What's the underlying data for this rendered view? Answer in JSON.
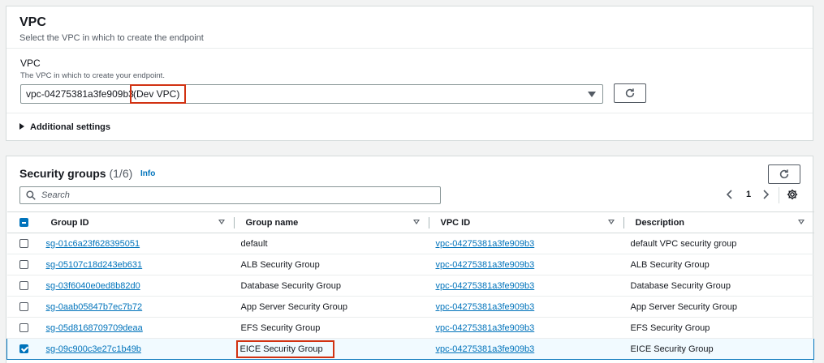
{
  "vpc_panel": {
    "title": "VPC",
    "subtitle": "Select the VPC in which to create the endpoint",
    "field_label": "VPC",
    "field_description": "The VPC in which to create your endpoint.",
    "selected_vpc_id": "vpc-04275381a3fe909b3",
    "selected_vpc_name": "(Dev VPC)",
    "additional_settings": "Additional settings"
  },
  "security_groups": {
    "title": "Security groups",
    "count": "(1/6)",
    "info": "Info",
    "search_placeholder": "Search",
    "page": "1",
    "columns": [
      "Group ID",
      "Group name",
      "VPC ID",
      "Description"
    ],
    "rows": [
      {
        "group_id": "sg-01c6a23f628395051",
        "group_name": "default",
        "vpc_id": "vpc-04275381a3fe909b3",
        "description": "default VPC security group",
        "checked": false
      },
      {
        "group_id": "sg-05107c18d243eb631",
        "group_name": "ALB Security Group",
        "vpc_id": "vpc-04275381a3fe909b3",
        "description": "ALB Security Group",
        "checked": false
      },
      {
        "group_id": "sg-03f6040e0ed8b82d0",
        "group_name": "Database Security Group",
        "vpc_id": "vpc-04275381a3fe909b3",
        "description": "Database Security Group",
        "checked": false
      },
      {
        "group_id": "sg-0aab05847b7ec7b72",
        "group_name": "App Server Security Group",
        "vpc_id": "vpc-04275381a3fe909b3",
        "description": "App Server Security Group",
        "checked": false
      },
      {
        "group_id": "sg-05d8168709709deaa",
        "group_name": "EFS Security Group",
        "vpc_id": "vpc-04275381a3fe909b3",
        "description": "EFS Security Group",
        "checked": false
      },
      {
        "group_id": "sg-09c900c3e27c1b49b",
        "group_name": "EICE Security Group",
        "vpc_id": "vpc-04275381a3fe909b3",
        "description": "EICE Security Group",
        "checked": true
      }
    ]
  },
  "colors": {
    "link": "#0073bb",
    "highlight_box": "#d13212",
    "selected_row_bg": "#f1faff"
  }
}
